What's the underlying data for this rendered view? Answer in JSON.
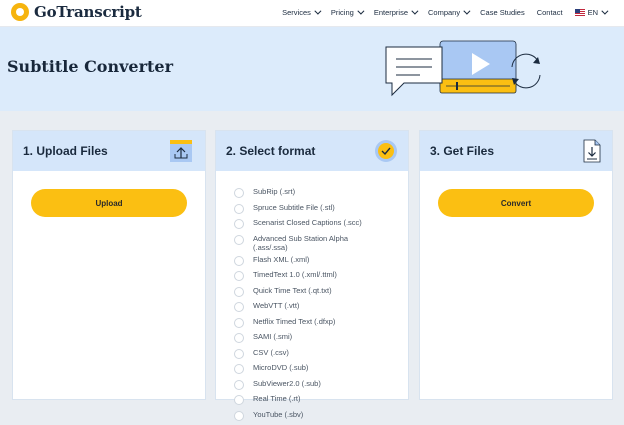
{
  "nav": {
    "brand": "GoTranscript",
    "items": [
      {
        "label": "Services",
        "dropdown": true
      },
      {
        "label": "Pricing",
        "dropdown": true
      },
      {
        "label": "Enterprise",
        "dropdown": true
      },
      {
        "label": "Company",
        "dropdown": true
      },
      {
        "label": "Case Studies",
        "dropdown": false
      },
      {
        "label": "Contact",
        "dropdown": false
      }
    ],
    "language": "EN"
  },
  "hero": {
    "title": "Subtitle Converter"
  },
  "steps": {
    "upload": {
      "title": "1. Upload Files",
      "button": "Upload",
      "icon": "upload-icon"
    },
    "format": {
      "title": "2. Select format",
      "icon": "check-circle-icon",
      "options": [
        "SubRip (.srt)",
        "Spruce Subtitle File (.stl)",
        "Scenarist Closed Captions (.scc)",
        "Advanced Sub Station Alpha (.ass/.ssa)",
        "Flash XML (.xml)",
        "TimedText 1.0 (.xml/.ttml)",
        "Quick Time Text (.qt.txt)",
        "WebVTT (.vtt)",
        "Netflix Timed Text (.dfxp)",
        "SAMI (.smi)",
        "CSV (.csv)",
        "MicroDVD (.sub)",
        "SubViewer2.0 (.sub)",
        "Real Time (.rt)",
        "YouTube (.sbv)"
      ]
    },
    "get": {
      "title": "3. Get Files",
      "button": "Convert",
      "icon": "download-icon"
    }
  },
  "colors": {
    "accent": "#fbbf12",
    "hero_bg": "#dcebfb",
    "panel_head": "#d5e6fa",
    "text": "#1a2a3d"
  }
}
